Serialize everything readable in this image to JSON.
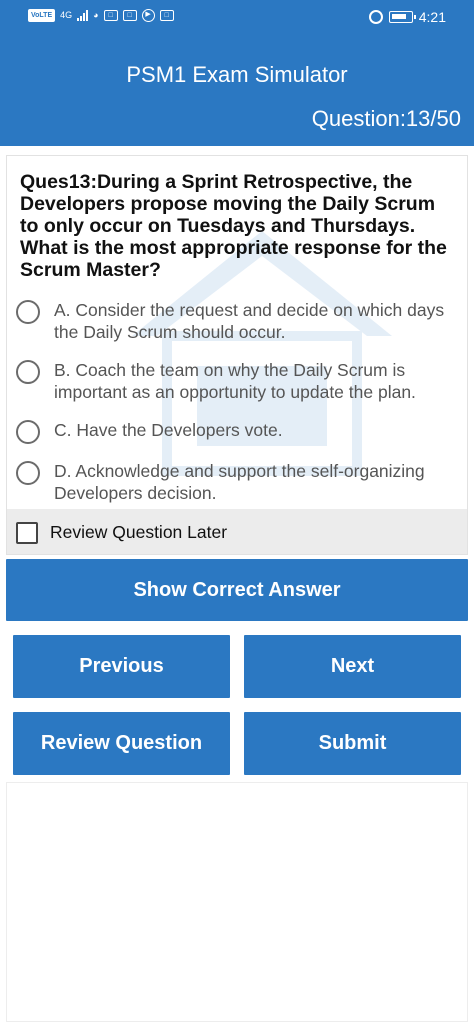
{
  "status_bar": {
    "volte": "VoLTE",
    "network": "4G",
    "time": "4:21"
  },
  "header": {
    "title": "PSM1 Exam Simulator",
    "question_counter": "Question:13/50"
  },
  "question": {
    "text": "Ques13:During a Sprint Retrospective, the Developers propose moving the Daily Scrum to only occur on Tuesdays and Thursdays. What is the most appropriate response for the Scrum Master?",
    "options": [
      {
        "label": "A. Consider the request and decide on which days the Daily Scrum should occur."
      },
      {
        "label": "B. Coach the team on why the Daily Scrum is important as an opportunity to update the plan."
      },
      {
        "label": "C. Have the Developers vote."
      },
      {
        "label": "D. Acknowledge and support the self-organizing Developers decision."
      }
    ],
    "review_later_label": "Review Question Later"
  },
  "buttons": {
    "show_answer": "Show Correct Answer",
    "previous": "Previous",
    "next": "Next",
    "review": "Review Question",
    "submit": "Submit"
  },
  "colors": {
    "primary": "#2b78c2",
    "review_bar": "#ececec"
  }
}
